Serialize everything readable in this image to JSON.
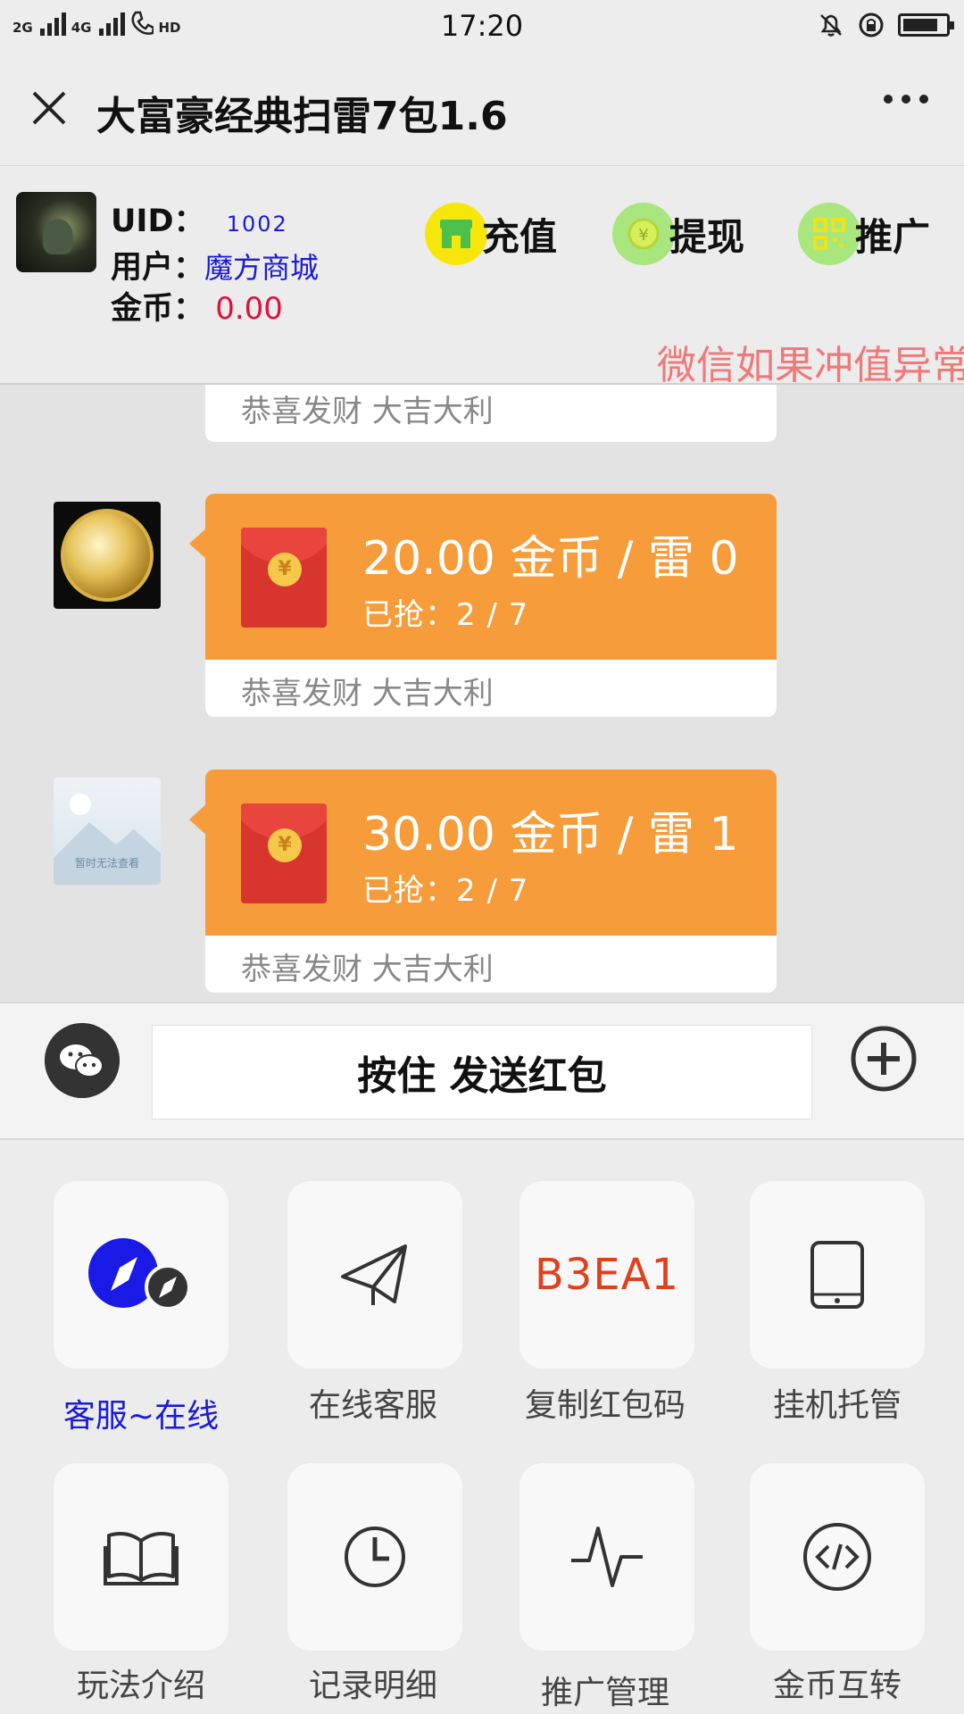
{
  "status_bar": {
    "network_1": "2G",
    "network_2": "4G",
    "hd": "HD",
    "time": "17:20",
    "icons": [
      "mute-icon",
      "alarm-lock-icon",
      "battery-icon"
    ]
  },
  "title_bar": {
    "title": "大富豪经典扫雷7包1.6"
  },
  "user": {
    "uid_label": "UID：",
    "uid_value": "1002",
    "user_label": "用户：",
    "user_value": "魔方商城",
    "coin_label": "金币：",
    "coin_value": "0.00"
  },
  "actions": [
    {
      "label": "充值",
      "icon": "shop-icon"
    },
    {
      "label": "提现",
      "icon": "yuan-coin-icon"
    },
    {
      "label": "推广",
      "icon": "qr-code-icon"
    }
  ],
  "marquee": "微信如果冲值异常",
  "messages": {
    "partial_blessing": "恭喜发财 大吉大利",
    "items": [
      {
        "amount": "20.00 金币 / 雷 0",
        "grabbed": "已抢：2 / 7",
        "blessing": "恭喜发财 大吉大利",
        "avatar": "medal-avatar"
      },
      {
        "amount": "30.00 金币 / 雷 1",
        "grabbed": "已抢：2 / 7",
        "blessing": "恭喜发财 大吉大利",
        "avatar": "placeholder-avatar",
        "placeholder_text": "暂时无法查看"
      }
    ]
  },
  "input_bar": {
    "send_label": "按住 发送红包"
  },
  "functions": [
    {
      "label": "客服~在线",
      "icon": "compass-icon",
      "highlight": true
    },
    {
      "label": "在线客服",
      "icon": "paper-plane-icon"
    },
    {
      "label": "复制红包码",
      "code": "B3EA1"
    },
    {
      "label": "挂机托管",
      "icon": "tablet-icon"
    },
    {
      "label": "玩法介绍",
      "icon": "book-icon"
    },
    {
      "label": "记录明细",
      "icon": "clock-icon"
    },
    {
      "label": "推广管理",
      "icon": "pulse-icon"
    },
    {
      "label": "金币互转",
      "icon": "code-icon"
    }
  ],
  "colors": {
    "red_packet": "#f79c3a",
    "envelope": "#d9352f",
    "link_blue": "#1a1ad8",
    "coin_red": "#e0103a",
    "code_orange": "#e0411d"
  }
}
